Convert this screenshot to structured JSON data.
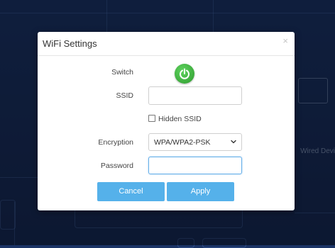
{
  "dialog": {
    "title": "WiFi Settings",
    "close_glyph": "×"
  },
  "form": {
    "switch_label": "Switch",
    "switch_state": "on",
    "ssid_label": "SSID",
    "ssid_value": "",
    "hidden_ssid_label": "Hidden SSID",
    "hidden_ssid_checked": false,
    "encryption_label": "Encryption",
    "encryption_value": "WPA/WPA2-PSK",
    "password_label": "Password",
    "password_value": ""
  },
  "buttons": {
    "cancel": "Cancel",
    "apply": "Apply"
  },
  "background": {
    "device_label": "Wired Devi"
  },
  "colors": {
    "primary_button": "#55b1ea",
    "power_on": "#3aaa3a",
    "backdrop": "#1b3466"
  },
  "icons": {
    "power": "power-icon",
    "caret": "chevron-down-icon",
    "close": "close-icon"
  }
}
